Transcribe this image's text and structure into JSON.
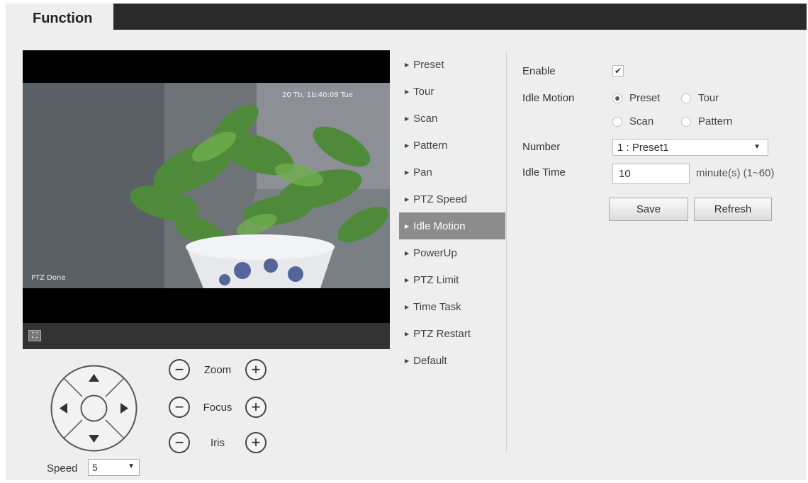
{
  "header": {
    "tab_label": "Function"
  },
  "video": {
    "timestamp_osd": "20 Tb, 1b:40:09 Tue",
    "status_osd": "PTZ Done"
  },
  "ptz": {
    "zoom_label": "Zoom",
    "focus_label": "Focus",
    "iris_label": "Iris",
    "minus_symbol": "−",
    "plus_symbol": "+",
    "speed_label": "Speed",
    "speed_value": "5"
  },
  "menu": {
    "items": [
      {
        "label": "Preset"
      },
      {
        "label": "Tour"
      },
      {
        "label": "Scan"
      },
      {
        "label": "Pattern"
      },
      {
        "label": "Pan"
      },
      {
        "label": "PTZ Speed"
      },
      {
        "label": "Idle Motion"
      },
      {
        "label": "PowerUp"
      },
      {
        "label": "PTZ Limit"
      },
      {
        "label": "Time Task"
      },
      {
        "label": "PTZ Restart"
      },
      {
        "label": "Default"
      }
    ],
    "active_index": 6
  },
  "form": {
    "enable_label": "Enable",
    "enable_checked": true,
    "idle_motion_label": "Idle Motion",
    "options": {
      "preset": "Preset",
      "tour": "Tour",
      "scan": "Scan",
      "pattern": "Pattern"
    },
    "selected_option": "Preset",
    "number_label": "Number",
    "number_value": "1 : Preset1",
    "idle_time_label": "Idle Time",
    "idle_time_value": "10",
    "idle_time_unit": "minute(s) (1~60)",
    "save_label": "Save",
    "refresh_label": "Refresh"
  },
  "colors": {
    "top_bar": "#2b2b2b",
    "panel_bg": "#eeeeee",
    "active_menu": "#8c8c8c"
  }
}
